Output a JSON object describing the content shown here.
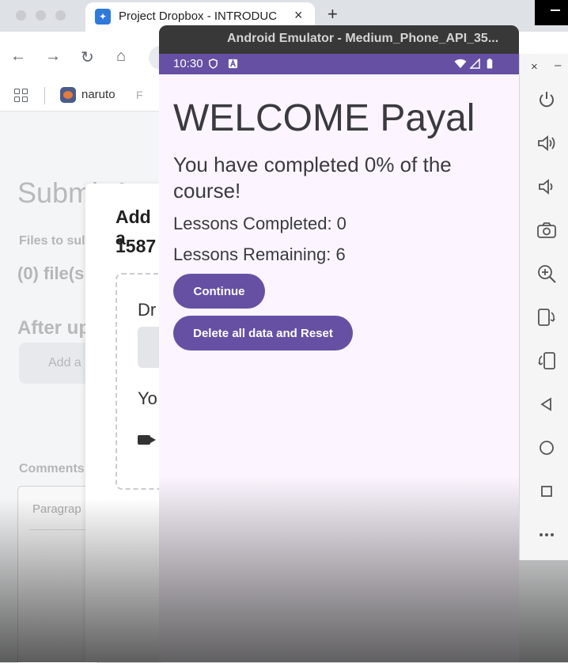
{
  "browser": {
    "tab_title": "Project Dropbox - INTRODUC",
    "tab_close": "×",
    "new_tab": "+",
    "bookmark_label": "naruto",
    "bookmark_second": "F",
    "page": {
      "heading": "Submit A",
      "files_label": "Files to sul",
      "files_count": "(0) file(s",
      "after_upload": "After up",
      "add_button": "Add a",
      "comments_label": "Comments",
      "editor_placeholder": "Paragrap"
    },
    "modal": {
      "title": "Add a",
      "number": "1587",
      "drop_text": "Dr",
      "you_text": "Yo"
    }
  },
  "emulator": {
    "window_title": "Android Emulator - Medium_Phone_API_35...",
    "status_time": "10:30",
    "accent": "#6650a4"
  },
  "app": {
    "welcome": "WELCOME Payal",
    "progress_text": "You have completed 0%  of the course!",
    "lessons_completed": "Lessons Completed: 0",
    "lessons_remaining": "Lessons Remaining: 6",
    "continue_label": "Continue",
    "reset_label": "Delete all data and Reset"
  },
  "toolbar": {
    "close": "×",
    "minimize": "–",
    "icons": [
      "power-icon",
      "volume-up-icon",
      "volume-down-icon",
      "camera-icon",
      "zoom-icon",
      "rotate-left-icon",
      "rotate-right-icon",
      "back-icon",
      "home-icon",
      "overview-icon",
      "more-icon"
    ]
  }
}
